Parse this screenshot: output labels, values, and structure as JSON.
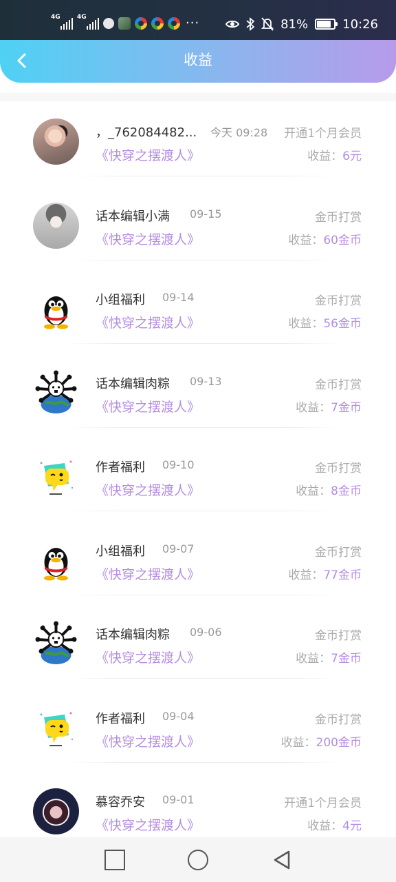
{
  "status_bar": {
    "network_1": "4G",
    "network_2": "4G",
    "more": "···",
    "battery_text": "81%",
    "battery_level": 0.81,
    "time": "10:26"
  },
  "header": {
    "back_icon": "chevron-left-icon",
    "title": "收益"
  },
  "list": [
    {
      "name": "，_762084482...",
      "date": "今天 09:28",
      "type": "开通1个月会员",
      "book": "《快穿之摆渡人》",
      "income_label": "收益：",
      "income_value": "6元",
      "avatar": "photo"
    },
    {
      "name": "话本编辑小满",
      "date": "09-15",
      "type": "金币打赏",
      "book": "《快穿之摆渡人》",
      "income_label": "收益：",
      "income_value": "60金币",
      "avatar": "anime"
    },
    {
      "name": "小组福利",
      "date": "09-14",
      "type": "金币打赏",
      "book": "《快穿之摆渡人》",
      "income_label": "收益：",
      "income_value": "56金币",
      "avatar": "penguin"
    },
    {
      "name": "话本编辑肉粽",
      "date": "09-13",
      "type": "金币打赏",
      "book": "《快穿之摆渡人》",
      "income_label": "收益：",
      "income_value": "7金币",
      "avatar": "earth"
    },
    {
      "name": "作者福利",
      "date": "09-10",
      "type": "金币打赏",
      "book": "《快穿之摆渡人》",
      "income_label": "收益：",
      "income_value": "8金币",
      "avatar": "chat"
    },
    {
      "name": "小组福利",
      "date": "09-07",
      "type": "金币打赏",
      "book": "《快穿之摆渡人》",
      "income_label": "收益：",
      "income_value": "77金币",
      "avatar": "penguin"
    },
    {
      "name": "话本编辑肉粽",
      "date": "09-06",
      "type": "金币打赏",
      "book": "《快穿之摆渡人》",
      "income_label": "收益：",
      "income_value": "7金币",
      "avatar": "earth"
    },
    {
      "name": "作者福利",
      "date": "09-04",
      "type": "金币打赏",
      "book": "《快穿之摆渡人》",
      "income_label": "收益：",
      "income_value": "200金币",
      "avatar": "chat"
    },
    {
      "name": "慕容乔安",
      "date": "09-01",
      "type": "开通1个月会员",
      "book": "《快穿之摆渡人》",
      "income_label": "收益：",
      "income_value": "4元",
      "avatar": "circle"
    }
  ],
  "nav": {
    "recent_icon": "square-icon",
    "home_icon": "circle-icon",
    "back_icon": "triangle-back-icon"
  },
  "colors": {
    "header_start": "#4fd1f4",
    "header_end": "#b79bea",
    "accent": "#b48de0"
  }
}
